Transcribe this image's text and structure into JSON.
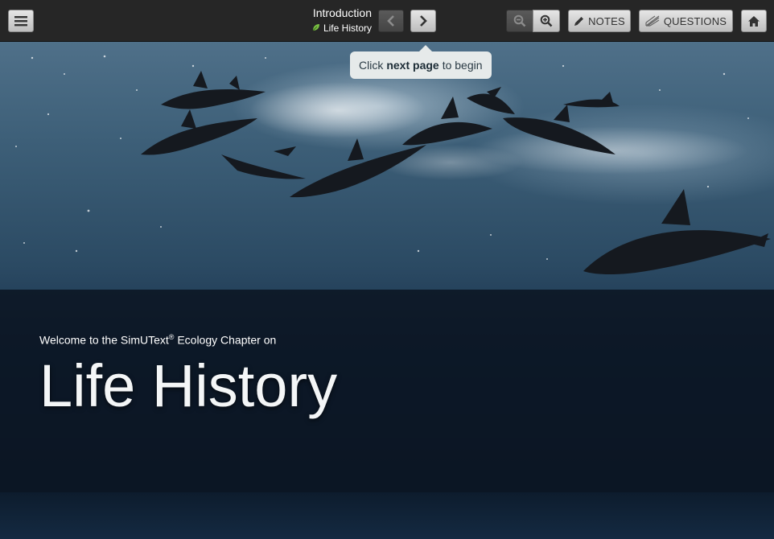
{
  "toolbar": {
    "menu_icon": "hamburger-menu-icon",
    "chapter_title": "Introduction",
    "section_title": "Life History",
    "section_icon": "leaf-icon",
    "prev_icon": "chevron-left-icon",
    "next_icon": "chevron-right-icon",
    "zoom_out_icon": "zoom-out-icon",
    "zoom_in_icon": "zoom-in-icon",
    "notes_label": "NOTES",
    "notes_icon": "pencil-icon",
    "questions_label": "QUESTIONS",
    "questions_icon": "questions-icon",
    "home_icon": "home-icon"
  },
  "hint": {
    "prefix": "Click",
    "bold": "next page",
    "suffix": "to begin"
  },
  "hero": {
    "welcome_before": "Welcome to the SimUText",
    "welcome_reg": "®",
    "welcome_after": " Ecology Chapter on",
    "title": "Life History",
    "image": "dolphins-leaping-from-ocean-photo"
  },
  "colors": {
    "toolbar_bg": "#262626",
    "band_bg": "#0a121e",
    "tooltip_bg": "#e6eaea",
    "leaf_green": "#7ac143"
  }
}
